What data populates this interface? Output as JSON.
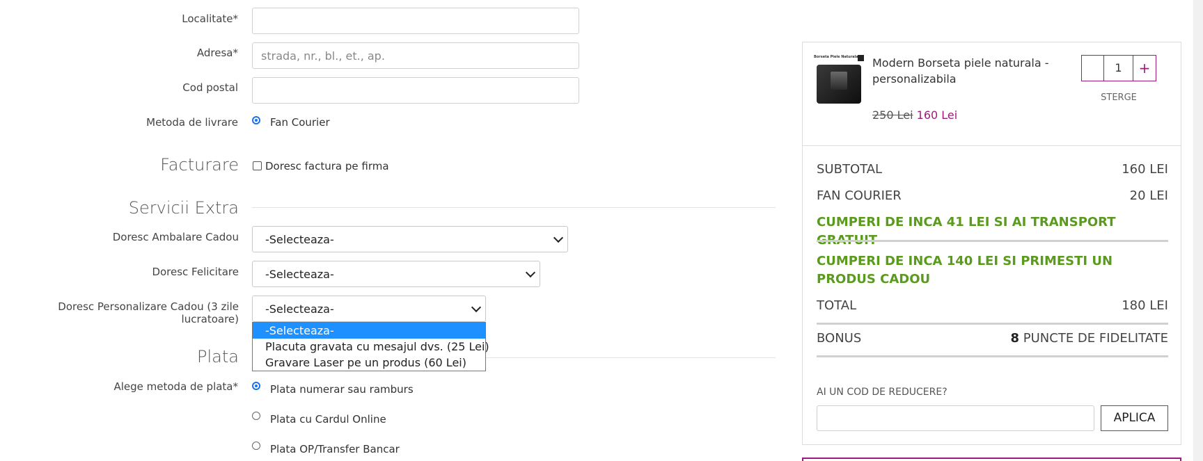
{
  "form": {
    "localitate_label": "Localitate*",
    "adresa_label": "Adresa*",
    "adresa_placeholder": "strada, nr., bl., et., ap.",
    "cod_postal_label": "Cod postal",
    "metoda_livrare_label": "Metoda de livrare",
    "metoda_livrare_option": "Fan Courier",
    "facturare_title": "Facturare",
    "factura_firma_label": "Doresc factura pe firma",
    "servicii_title": "Servicii Extra",
    "ambalare_label": "Doresc Ambalare Cadou",
    "ambalare_value": "-Selecteaza-",
    "felicitare_label": "Doresc Felicitare",
    "felicitare_value": "-Selecteaza-",
    "personalizare_label": "Doresc Personalizare Cadou (3 zile lucratoare)",
    "personalizare_value": "-Selecteaza-",
    "personalizare_options": [
      "-Selecteaza-",
      "Placuta gravata cu mesajul dvs. (25 Lei)",
      "Gravare Laser pe un produs (60 Lei)"
    ],
    "plata_title": "Plata",
    "plata_label": "Alege metoda de plata*",
    "plata_options": [
      "Plata numerar sau ramburs",
      "Plata cu Cardul Online",
      "Plata OP/Transfer Bancar"
    ]
  },
  "cart": {
    "product_thumb_text": "Borseta Piele Naturala",
    "product_name": "Modern Borseta piele naturala - personalizabila",
    "old_price": "250 Lei",
    "new_price": "160 Lei",
    "quantity": "1",
    "plus": "+",
    "remove": "STERGE",
    "subtotal_label": "SUBTOTAL",
    "subtotal_value": "160 LEI",
    "shipping_label": "FAN COURIER",
    "shipping_value": "20 LEI",
    "promo_shipping": "CUMPERI DE INCA 41 LEI SI AI TRANSPORT GRATUIT",
    "promo_gift": "CUMPERI DE INCA 140 LEI SI PRIMESTI UN PRODUS CADOU",
    "total_label": "TOTAL",
    "total_value": "180 LEI",
    "bonus_label": "BONUS",
    "bonus_points": "8",
    "bonus_text": "PUNCTE DE FIDELITATE",
    "discount_label": "AI UN COD DE REDUCERE?",
    "apply_label": "APLICA"
  },
  "colors": {
    "accent": "#9b1b7a",
    "green": "#5a9a1e",
    "highlight": "#1e90ff"
  }
}
